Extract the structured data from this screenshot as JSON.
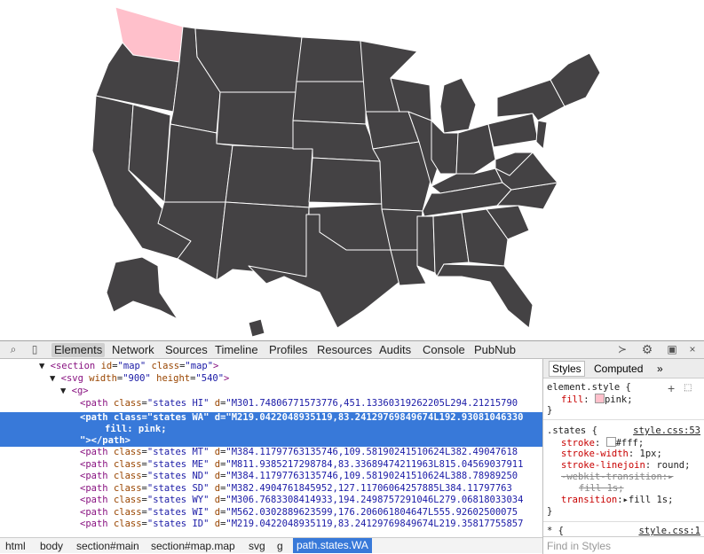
{
  "colors": {
    "state_fill": "#444244",
    "highlight_fill": "pink",
    "selection": "#3879d9"
  },
  "devtools": {
    "tabs": [
      "Elements",
      "Network",
      "Sources",
      "Timeline",
      "Profiles",
      "Resources",
      "Audits",
      "Console",
      "PubNub"
    ],
    "icons": [
      "search-icon",
      "device-icon",
      "execute-icon",
      "gear-icon",
      "dock-icon",
      "close-icon"
    ]
  },
  "dom": {
    "l1": {
      "arrow": "▼",
      "tag": "<section",
      "a1": "id",
      "v1": "\"map\"",
      "a2": "class",
      "v2": "\"map\"",
      "end": ">"
    },
    "l2": {
      "arrow": "▼",
      "tag": "<svg",
      "a1": "width",
      "v1": "\"900\"",
      "a2": "height",
      "v2": "\"540\"",
      "end": ">"
    },
    "l3": {
      "arrow": "▼",
      "tag": "<g>"
    },
    "paths": [
      {
        "cls": "\"states HI\"",
        "d": "\"M301.74806771573776,451.13360319262205L294.21215790"
      },
      {
        "cls": "\"states WA\"",
        "d": "\"M219.0422048935119,83.24129769849674L192.93081046330"
      },
      {
        "cls": "\"states MT\"",
        "d": "\"M384.11797763135746,109.58190241510624L382.49047618"
      },
      {
        "cls": "\"states ME\"",
        "d": "\"M811.9385217298784,83.33689474211963L815.04569037911"
      },
      {
        "cls": "\"states ND\"",
        "d": "\"M384.11797763135746,109.58190241510624L388.78989250"
      },
      {
        "cls": "\"states SD\"",
        "d": "\"M382.4904761845952,127.11706064257885L384.11797763"
      },
      {
        "cls": "\"states WY\"",
        "d": "\"M306.7683308414933,194.2498757291046L279.06818033034"
      },
      {
        "cls": "\"states WI\"",
        "d": "\"M562.0302889623599,176.206061804647L555.92602500075"
      },
      {
        "cls": "\"states ID\"",
        "d": "\"M219.0422048935119,83.24129769849674L219.35817755857"
      }
    ],
    "path_tag": "<path",
    "class_attr": "class",
    "d_attr": "d",
    "path_end": "></path>",
    "inline_style": "fill: pink;",
    "close_line": "\"></path>"
  },
  "breadcrumbs": [
    "html",
    "body",
    "section#main",
    "section#map.map",
    "svg",
    "g",
    "path.states.WA"
  ],
  "styles_sidebar": {
    "tabs": [
      "Styles",
      "Computed"
    ],
    "more": "»",
    "element_style": {
      "selector": "element.style {",
      "prop": "fill",
      "value": "pink;",
      "close": "}"
    },
    "states_rule": {
      "selector": ".states {",
      "source": "style.css:53",
      "props": [
        {
          "name": "stroke",
          "value": "#fff;"
        },
        {
          "name": "stroke-width",
          "value": "1px;"
        },
        {
          "name": "stroke-linejoin",
          "value": "round;"
        },
        {
          "name": "-webkit-transition",
          "value": ""
        },
        {
          "name": "fill 1s;",
          "value": ""
        },
        {
          "name": "transition",
          "value": "fill 1s;"
        }
      ],
      "close": "}"
    },
    "star_rule": {
      "selector": "* {",
      "source": "style.css:1"
    },
    "find_placeholder": "Find in Styles"
  }
}
